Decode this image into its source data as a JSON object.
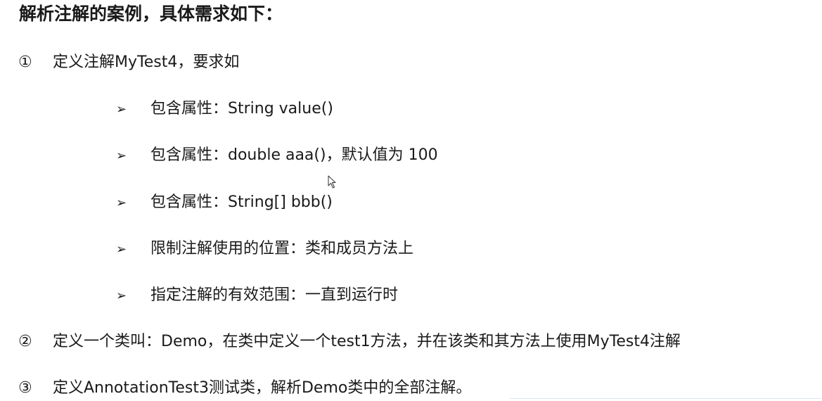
{
  "title": "解析注解的案例，具体需求如下：",
  "items": [
    {
      "num": "①",
      "text": "定义注解MyTest4，要求如"
    },
    {
      "num": "②",
      "text": "定义一个类叫：Demo，在类中定义一个test1方法，并在该类和其方法上使用MyTest4注解"
    },
    {
      "num": "③",
      "text": "定义AnnotationTest3测试类，解析Demo类中的全部注解。"
    }
  ],
  "bullet_marker": "➢",
  "bullets": [
    "包含属性：String value()",
    "包含属性：double aaa()，默认值为 100",
    "包含属性：String[] bbb()",
    "限制注解使用的位置：类和成员方法上",
    "指定注解的有效范围：一直到运行时"
  ],
  "icons": {
    "cursor": "mouse-pointer-icon"
  },
  "colors": {
    "text": "#1a1a1a",
    "background": "#ffffff"
  }
}
